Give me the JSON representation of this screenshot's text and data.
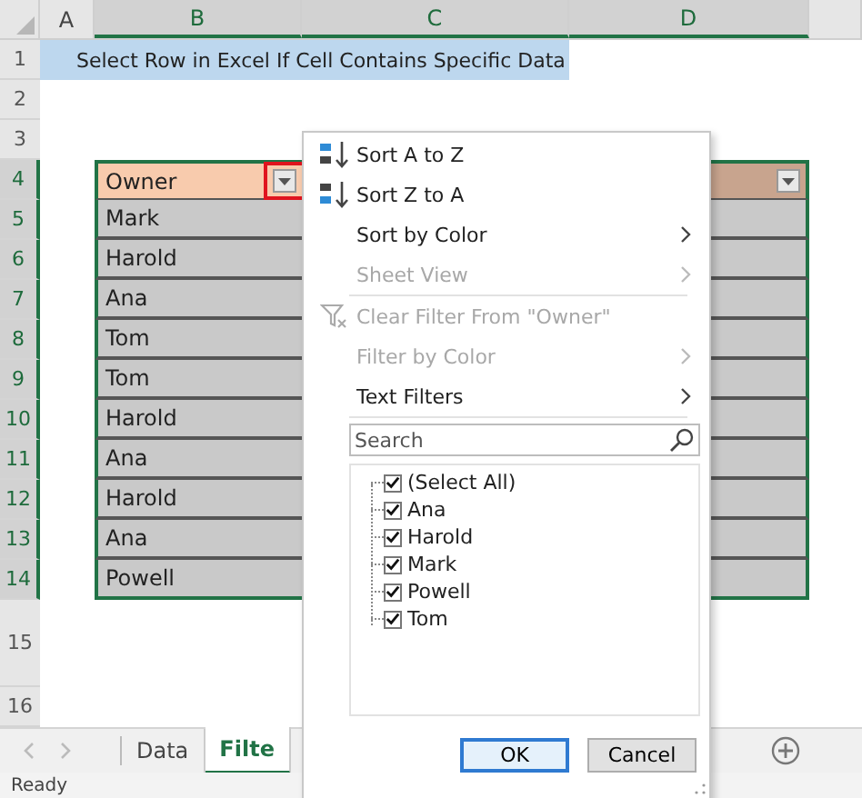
{
  "column_headers": [
    {
      "label": "A",
      "selected": false
    },
    {
      "label": "B",
      "selected": true
    },
    {
      "label": "C",
      "selected": true
    },
    {
      "label": "D",
      "selected": true
    }
  ],
  "row_numbers": [
    {
      "label": "1",
      "selected": false
    },
    {
      "label": "2",
      "selected": false
    },
    {
      "label": "3",
      "selected": false
    },
    {
      "label": "4",
      "selected": true
    },
    {
      "label": "5",
      "selected": true
    },
    {
      "label": "6",
      "selected": true
    },
    {
      "label": "7",
      "selected": true
    },
    {
      "label": "8",
      "selected": true
    },
    {
      "label": "9",
      "selected": true
    },
    {
      "label": "10",
      "selected": true
    },
    {
      "label": "11",
      "selected": true
    },
    {
      "label": "12",
      "selected": true
    },
    {
      "label": "13",
      "selected": true
    },
    {
      "label": "14",
      "selected": true
    },
    {
      "label": "15",
      "selected": false
    },
    {
      "label": "16",
      "selected": false
    }
  ],
  "title_cell": "Select Row in Excel If Cell Contains Specific Data",
  "table": {
    "header": "Owner",
    "rows": [
      "Mark",
      "Harold",
      "Ana",
      "Tom",
      "Tom",
      "Harold",
      "Ana",
      "Harold",
      "Ana",
      "Powell"
    ]
  },
  "filter_menu": {
    "items": [
      {
        "kind": "sort_ascending",
        "label": "Sort A to Z",
        "disabled": false,
        "submenu": false
      },
      {
        "kind": "sort_descending",
        "label": "Sort Z to A",
        "disabled": false,
        "submenu": false
      },
      {
        "kind": "plain",
        "label": "Sort by Color",
        "disabled": false,
        "submenu": true
      },
      {
        "kind": "plain",
        "label": "Sheet View",
        "disabled": true,
        "submenu": true
      },
      {
        "kind": "divider"
      },
      {
        "kind": "clear_filter",
        "label": "Clear Filter From \"Owner\"",
        "disabled": true,
        "submenu": false
      },
      {
        "kind": "plain",
        "label": "Filter by Color",
        "disabled": true,
        "submenu": true
      },
      {
        "kind": "plain",
        "label": "Text Filters",
        "disabled": false,
        "submenu": true
      },
      {
        "kind": "divider"
      }
    ],
    "search": {
      "placeholder": "Search"
    },
    "values": [
      {
        "label": "(Select All)",
        "checked": true
      },
      {
        "label": "Ana",
        "checked": true
      },
      {
        "label": "Harold",
        "checked": true
      },
      {
        "label": "Mark",
        "checked": true
      },
      {
        "label": "Powell",
        "checked": true
      },
      {
        "label": "Tom",
        "checked": true
      }
    ],
    "buttons": [
      {
        "label": "OK",
        "default": true
      },
      {
        "label": "Cancel",
        "default": false
      }
    ]
  },
  "sheet_tabs": [
    {
      "label": "Data",
      "selected": false
    },
    {
      "label": "Filte",
      "selected": true
    }
  ],
  "status_bar": "Ready"
}
